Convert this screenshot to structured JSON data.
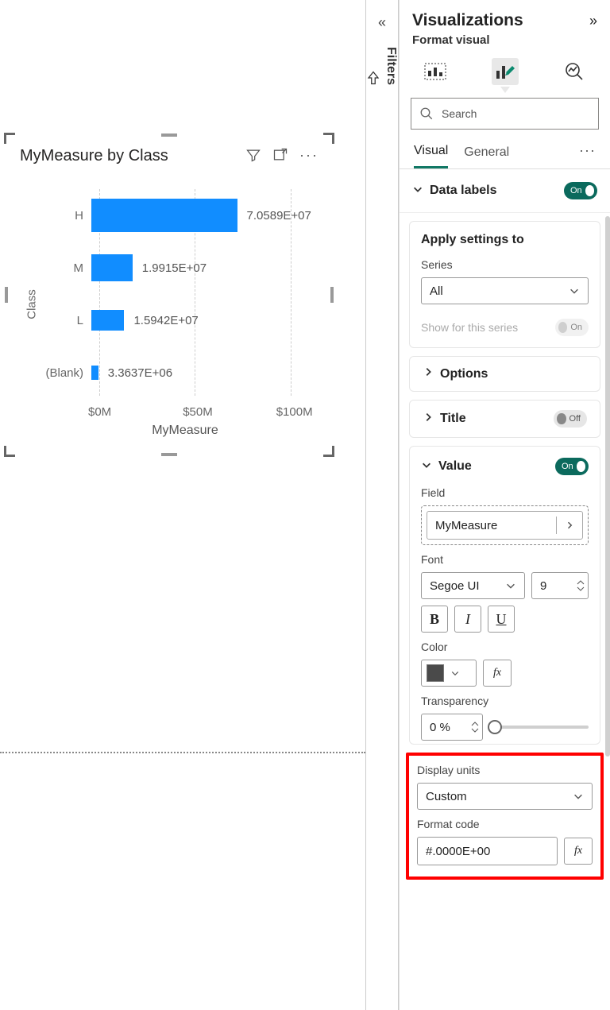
{
  "chart": {
    "title": "MyMeasure by Class",
    "ylabel": "Class",
    "xlabel": "MyMeasure"
  },
  "chart_data": {
    "type": "bar",
    "orientation": "horizontal",
    "categories": [
      "H",
      "M",
      "L",
      "(Blank)"
    ],
    "values": [
      70589000,
      19915000,
      15942000,
      3363700
    ],
    "data_labels": [
      "7.0589E+07",
      "1.9915E+07",
      "1.5942E+07",
      "3.3637E+06"
    ],
    "title": "MyMeasure by Class",
    "xlabel": "MyMeasure",
    "ylabel": "Class",
    "xlim": [
      0,
      100000000
    ],
    "x_ticks": [
      "$0M",
      "$50M",
      "$100M"
    ],
    "bar_color": "#118DFF"
  },
  "filters": {
    "label": "Filters"
  },
  "viz": {
    "title": "Visualizations",
    "subtitle": "Format visual",
    "search_placeholder": "Search",
    "tabs": {
      "visual": "Visual",
      "general": "General"
    },
    "data_labels": {
      "title": "Data labels",
      "toggle": "On"
    },
    "apply": {
      "title": "Apply settings to",
      "series_label": "Series",
      "series_value": "All",
      "show_series": "Show for this series",
      "show_toggle": "On"
    },
    "options": {
      "title": "Options"
    },
    "title_sec": {
      "title": "Title",
      "toggle": "Off"
    },
    "value": {
      "title": "Value",
      "toggle": "On",
      "field_label": "Field",
      "field_value": "MyMeasure",
      "font_label": "Font",
      "font_value": "Segoe UI",
      "font_size": "9",
      "bold": "B",
      "italic": "I",
      "underline": "U",
      "color_label": "Color",
      "transparency_label": "Transparency",
      "transparency_value": "0 %",
      "display_units_label": "Display units",
      "display_units_value": "Custom",
      "format_code_label": "Format code",
      "format_code_value": "#.0000E+00"
    }
  }
}
